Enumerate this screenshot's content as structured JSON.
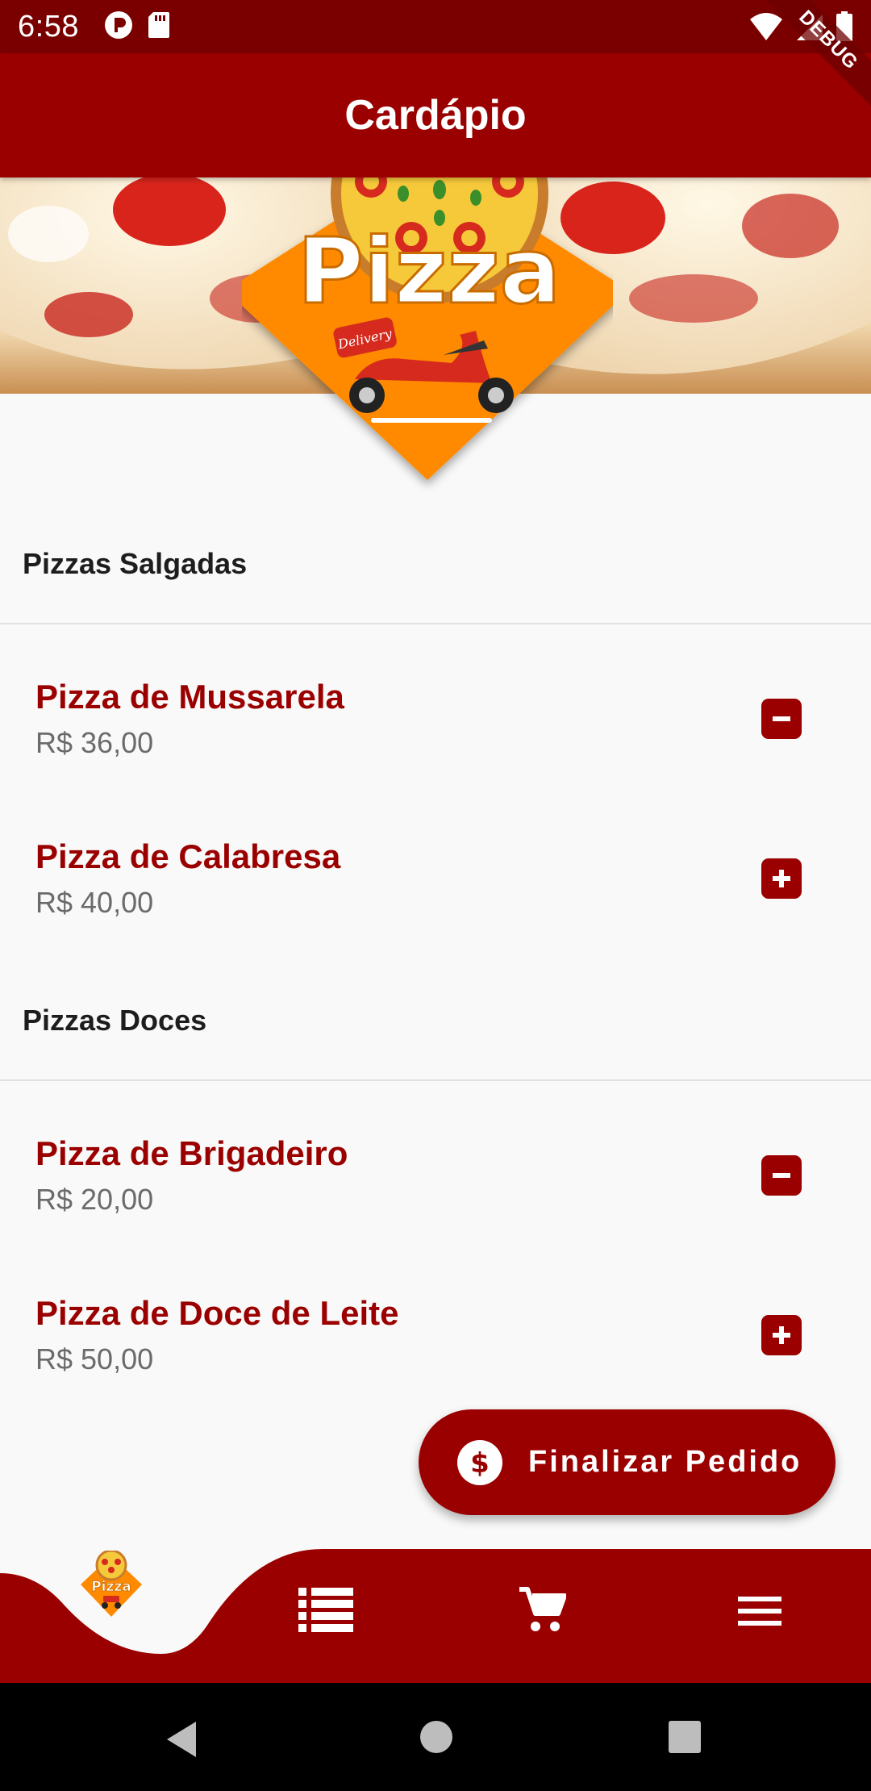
{
  "status_bar": {
    "time": "6:58",
    "left_icons": [
      "app-notification-icon",
      "sd-card-icon"
    ],
    "right_icons": [
      "wifi-icon",
      "signal-icon",
      "battery-icon"
    ],
    "debug_label": "DEBUG"
  },
  "app_bar": {
    "title": "Cardápio"
  },
  "banner": {
    "logo_text": "Pizza",
    "logo_sub": "Delivery"
  },
  "sections": [
    {
      "title": "Pizzas Salgadas",
      "items": [
        {
          "name": "Pizza de Mussarela",
          "price": "R$ 36,00",
          "action": "remove"
        },
        {
          "name": "Pizza de Calabresa",
          "price": "R$ 40,00",
          "action": "add"
        }
      ]
    },
    {
      "title": "Pizzas Doces",
      "items": [
        {
          "name": "Pizza de Brigadeiro",
          "price": "R$ 20,00",
          "action": "remove"
        },
        {
          "name": "Pizza de Doce de Leite",
          "price": "R$ 50,00",
          "action": "add"
        }
      ]
    }
  ],
  "fab": {
    "label": "Finalizar Pedido",
    "icon": "dollar-icon"
  },
  "bottom_nav": {
    "items": [
      {
        "icon": "pizza-logo-icon",
        "label": "Pizza",
        "active": true
      },
      {
        "icon": "list-icon"
      },
      {
        "icon": "cart-icon"
      },
      {
        "icon": "menu-icon"
      }
    ]
  },
  "colors": {
    "primary": "#9b0000",
    "status_bar": "#7a0000",
    "background": "#f9f9f9",
    "logo_orange": "#ff8a00"
  }
}
